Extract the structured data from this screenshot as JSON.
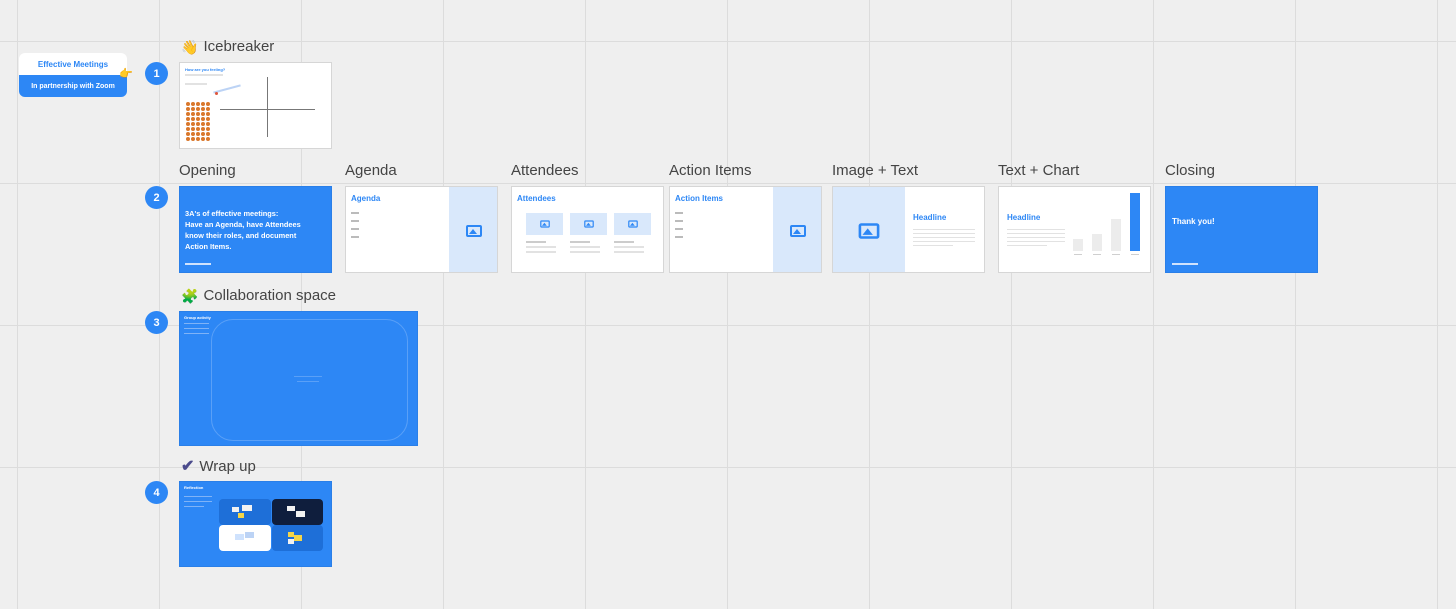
{
  "logo": {
    "title": "Effective Meetings",
    "subtitle": "In partnership with Zoom"
  },
  "sections": [
    {
      "number": "1",
      "title": "Icebreaker",
      "icon": "waving-hand-icon"
    },
    {
      "number": "2"
    },
    {
      "number": "3",
      "title": "Collaboration space",
      "icon": "puzzle-icon"
    },
    {
      "number": "4",
      "title": "Wrap up",
      "icon": "check-mark-icon"
    }
  ],
  "icebreaker": {
    "heading": "How are you feeling?"
  },
  "frames": {
    "opening": {
      "label": "Opening",
      "text_lines": [
        "3A's of effective meetings:",
        "Have an Agenda, have Attendees",
        "know their roles, and document",
        "Action Items."
      ]
    },
    "agenda": {
      "label": "Agenda",
      "heading": "Agenda"
    },
    "attendees": {
      "label": "Attendees",
      "heading": "Attendees"
    },
    "action_items": {
      "label": "Action Items",
      "heading": "Action Items"
    },
    "image_text": {
      "label": "Image + Text",
      "heading": "Headline"
    },
    "text_chart": {
      "label": "Text + Chart",
      "heading": "Headline",
      "bars": [
        0.2,
        0.3,
        0.55,
        1.0
      ]
    },
    "closing": {
      "label": "Closing",
      "heading": "Thank you!"
    }
  },
  "collab": {
    "heading": "Group activity"
  },
  "wrapup": {
    "heading": "Reflection"
  },
  "colors": {
    "accent": "#2d87f5",
    "navy": "#0f1e3d",
    "sticky_yellow": "#f5d547"
  }
}
